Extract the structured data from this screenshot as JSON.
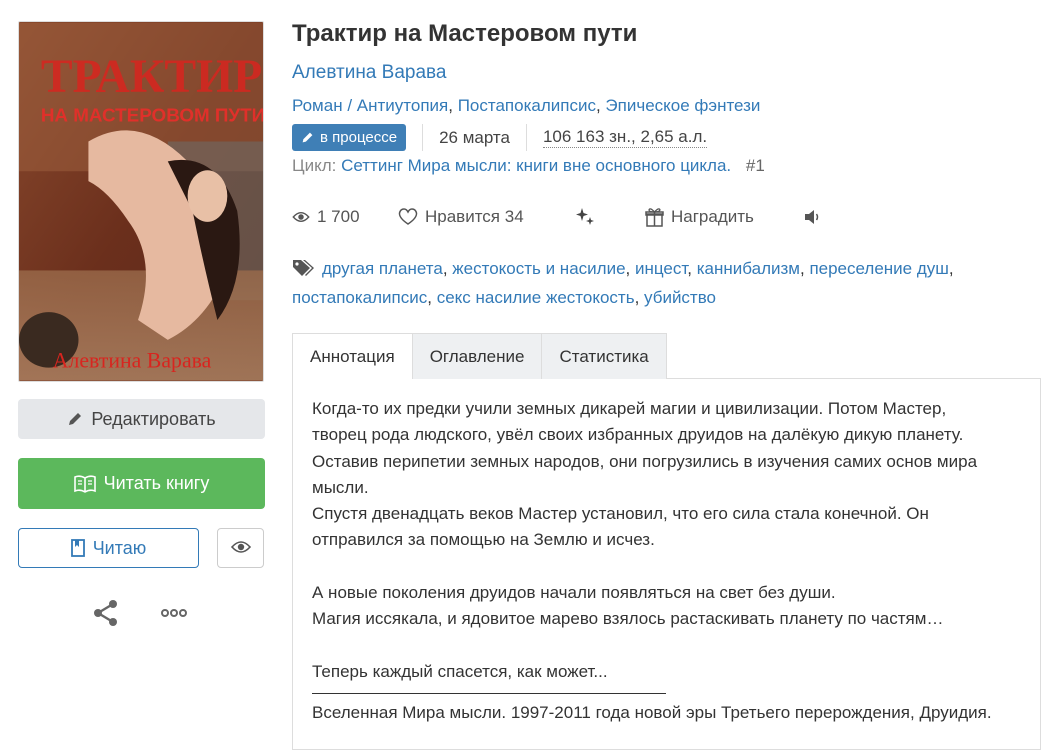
{
  "book": {
    "title": "Трактир на Мастеровом пути",
    "author": "Алевтина Варава",
    "genres": [
      "Роман",
      "Антиутопия",
      "Постапокалипсис",
      "Эпическое фэнтези"
    ],
    "status": "в процессе",
    "date": "26 марта",
    "size": "106 163 зн., 2,65 а.л.",
    "cycle_label": "Цикл:",
    "cycle_name": "Сеттинг Мира мысли: книги вне основного цикла.",
    "cycle_number": "#1"
  },
  "cover": {
    "title_line1": "ТРАКТИР",
    "title_line2": "НА МАСТЕРОВОМ ПУТИ",
    "author": "Алевтина Варава"
  },
  "stats": {
    "views": "1 700",
    "likes_label": "Нравится",
    "likes_count": "34",
    "reward_label": "Наградить"
  },
  "tags": [
    "другая планета",
    "жестокость и насилие",
    "инцест",
    "каннибализм",
    "переселение душ",
    "постапокалипсис",
    "секс насилие жестокость",
    "убийство"
  ],
  "actions": {
    "edit": "Редактировать",
    "read": "Читать книгу",
    "reading": "Читаю"
  },
  "tabs": [
    "Аннотация",
    "Оглавление",
    "Статистика"
  ],
  "annotation": {
    "lines": [
      "Когда-то их предки учили земных дикарей магии и цивилизации. Потом Мастер,",
      "творец рода людского, увёл своих избранных друидов на далёкую дикую планету.",
      "Оставив перипетии земных народов, они погрузились в изучения самих основ мира",
      "мысли.",
      "Спустя двенадцать веков Мастер установил, что его сила стала конечной. Он",
      "отправился за помощью на Землю и исчез.",
      "",
      "А новые поколения друидов начали появляться на свет без души.",
      "Магия иссякала, и ядовитое марево взялось растаскивать планету по частям…",
      "",
      "Теперь каждый спасется, как может..."
    ],
    "footer": "Вселенная Мира мысли. 1997-2011 года новой эры Третьего перерождения, Друидия."
  },
  "colors": {
    "link": "#337ab7",
    "read_button": "#5cb85c",
    "status_badge": "#3f7fb6",
    "edit_button": "#e5e7ea"
  }
}
